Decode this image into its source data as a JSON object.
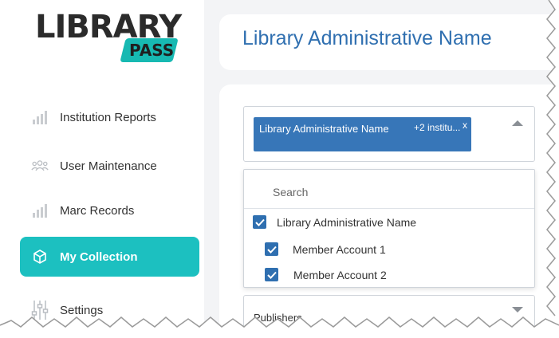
{
  "logo": {
    "word": "LIBRARY",
    "badge": "PASS",
    "badge_color": "#17b9b2"
  },
  "sidebar": {
    "items": [
      {
        "label": "Institution Reports",
        "icon": "bar-chart-icon",
        "active": false
      },
      {
        "label": "User Maintenance",
        "icon": "users-icon",
        "active": false
      },
      {
        "label": "Marc Records",
        "icon": "bar-chart-icon",
        "active": false
      },
      {
        "label": "My Collection",
        "icon": "cube-icon",
        "active": true
      },
      {
        "label": "Settings",
        "icon": "sliders-icon",
        "active": false
      }
    ],
    "active_color": "#1cc0c0"
  },
  "header": {
    "title": "Library Administrative Name",
    "title_color": "#2f6fb0"
  },
  "institution_select": {
    "chip_label": "Library Administrative Name",
    "chip_more": "+2 institu...",
    "chip_remove": "x",
    "chip_color": "#3776b8"
  },
  "dropdown": {
    "search_placeholder": "Search",
    "options": [
      {
        "label": "Library Administrative Name",
        "checked": true
      },
      {
        "label": "Member Account 1",
        "checked": true
      },
      {
        "label": "Member Account 2",
        "checked": true
      }
    ]
  },
  "publishers_select": {
    "label": "Publishers"
  }
}
